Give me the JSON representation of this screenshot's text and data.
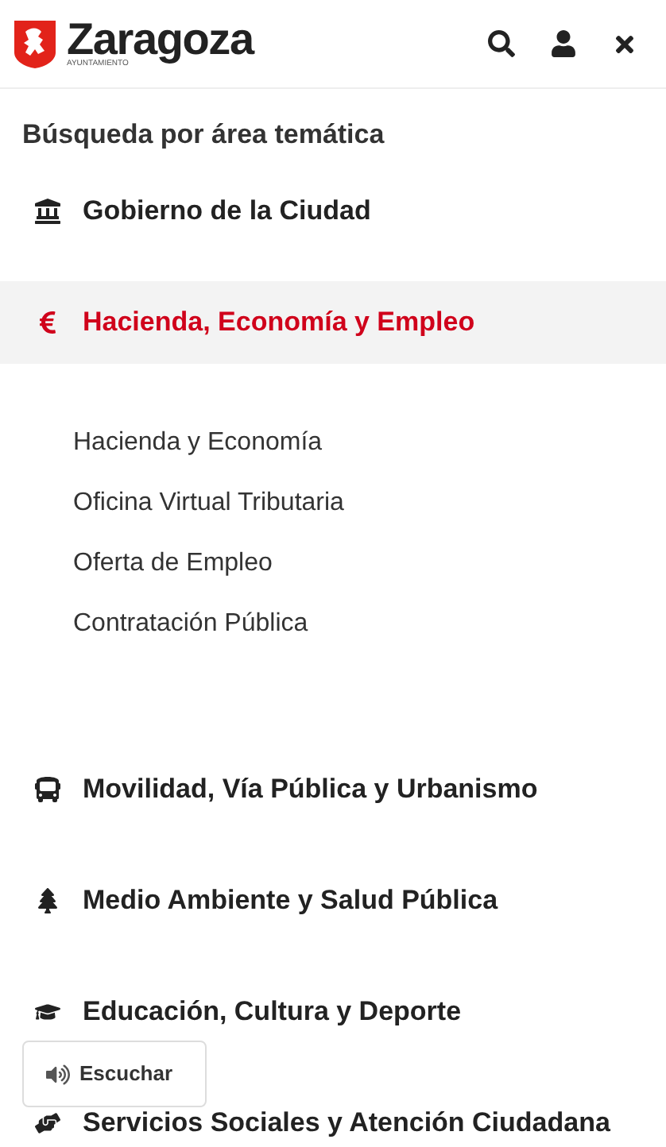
{
  "header": {
    "logo_title": "Zaragoza",
    "logo_subtitle": "AYUNTAMIENTO"
  },
  "heading": "Búsqueda por área temática",
  "areas": [
    {
      "label": "Gobierno de la Ciudad",
      "expanded": false
    },
    {
      "label": "Hacienda, Economía y Empleo",
      "expanded": true,
      "children": [
        {
          "label": "Hacienda y Economía"
        },
        {
          "label": "Oficina Virtual Tributaria"
        },
        {
          "label": "Oferta de Empleo"
        },
        {
          "label": "Contratación Pública"
        }
      ]
    },
    {
      "label": "Movilidad, Vía Pública y Urbanismo",
      "expanded": false
    },
    {
      "label": "Medio Ambiente y Salud Pública",
      "expanded": false
    },
    {
      "label": "Educación, Cultura y Deporte",
      "expanded": false
    },
    {
      "label": "Servicios Sociales y Atención Ciudadana",
      "expanded": false
    }
  ],
  "listen_button": "Escuchar"
}
